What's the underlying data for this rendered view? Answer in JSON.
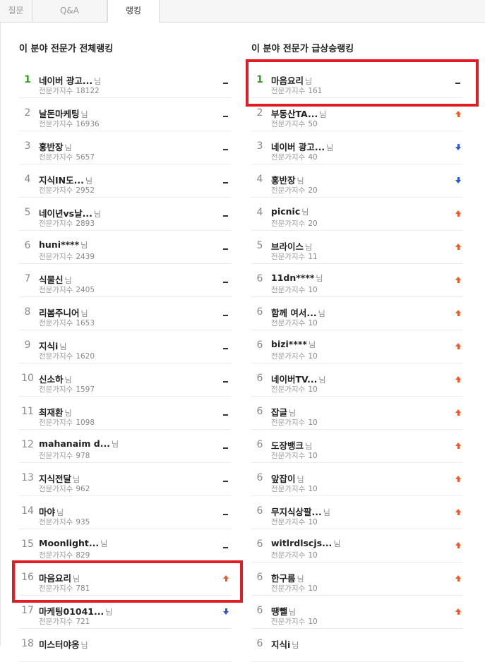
{
  "tabs": [
    {
      "label": "질문",
      "active": false
    },
    {
      "label": "Q&A",
      "active": false
    },
    {
      "label": "랭킹",
      "active": true
    }
  ],
  "colors": {
    "top_rank": "#3a9a2c",
    "trend_up": "#f05a28",
    "trend_down": "#2f56d6",
    "highlight": "#e31b23"
  },
  "left_column": {
    "title": "이 분야 전문가 전체랭킹",
    "rows": [
      {
        "rank": "1",
        "name": "네이버 광고...",
        "suffix": "님",
        "score_label": "전문가지수",
        "score": "18122",
        "trend": "dash"
      },
      {
        "rank": "2",
        "name": "날돈마케팅",
        "suffix": "님",
        "score_label": "전문가지수",
        "score": "16936",
        "trend": "dash"
      },
      {
        "rank": "3",
        "name": "홍반장",
        "suffix": "님",
        "score_label": "전문가지수",
        "score": "5657",
        "trend": "dash"
      },
      {
        "rank": "4",
        "name": "지식IN도...",
        "suffix": "님",
        "score_label": "전문가지수",
        "score": "2952",
        "trend": "dash"
      },
      {
        "rank": "5",
        "name": "네이년vs날...",
        "suffix": "님",
        "score_label": "전문가지수",
        "score": "2893",
        "trend": "dash"
      },
      {
        "rank": "6",
        "name": "huni****",
        "suffix": "님",
        "score_label": "전문가지수",
        "score": "2439",
        "trend": "dash"
      },
      {
        "rank": "7",
        "name": "식물신",
        "suffix": "님",
        "score_label": "전문가지수",
        "score": "2405",
        "trend": "dash"
      },
      {
        "rank": "8",
        "name": "리봄주니어",
        "suffix": "님",
        "score_label": "전문가지수",
        "score": "1653",
        "trend": "dash"
      },
      {
        "rank": "9",
        "name": "지식i",
        "suffix": "님",
        "score_label": "전문가지수",
        "score": "1620",
        "trend": "dash"
      },
      {
        "rank": "10",
        "name": "신소하",
        "suffix": "님",
        "score_label": "전문가지수",
        "score": "1597",
        "trend": "dash"
      },
      {
        "rank": "11",
        "name": "최재환",
        "suffix": "님",
        "score_label": "전문가지수",
        "score": "1098",
        "trend": "dash"
      },
      {
        "rank": "12",
        "name": "mahanaim d...",
        "suffix": "님",
        "score_label": "전문가지수",
        "score": "978",
        "trend": "dash"
      },
      {
        "rank": "13",
        "name": "지식전달",
        "suffix": "님",
        "score_label": "전문가지수",
        "score": "962",
        "trend": "dash"
      },
      {
        "rank": "14",
        "name": "마야",
        "suffix": "님",
        "score_label": "전문가지수",
        "score": "935",
        "trend": "dash"
      },
      {
        "rank": "15",
        "name": "Moonlight...",
        "suffix": "님",
        "score_label": "전문가지수",
        "score": "829",
        "trend": "dash"
      },
      {
        "rank": "16",
        "name": "마음요리",
        "suffix": "님",
        "score_label": "전문가지수",
        "score": "781",
        "trend": "up",
        "highlighted": true
      },
      {
        "rank": "17",
        "name": "마케팅01041...",
        "suffix": "님",
        "score_label": "전문가지수",
        "score": "721",
        "trend": "down"
      },
      {
        "rank": "18",
        "name": "미스터야옹",
        "suffix": "님",
        "score_label": "",
        "score": "",
        "trend": "none"
      }
    ]
  },
  "right_column": {
    "title": "이 분야 전문가 급상승랭킹",
    "rows": [
      {
        "rank": "1",
        "name": "마음요리",
        "suffix": "님",
        "score_label": "전문가지수",
        "score": "161",
        "trend": "dash",
        "highlighted": true
      },
      {
        "rank": "2",
        "name": "부동산TA...",
        "suffix": "님",
        "score_label": "전문가지수",
        "score": "50",
        "trend": "up"
      },
      {
        "rank": "3",
        "name": "네이버 광고...",
        "suffix": "님",
        "score_label": "전문가지수",
        "score": "40",
        "trend": "down"
      },
      {
        "rank": "4",
        "name": "홍반장",
        "suffix": "님",
        "score_label": "전문가지수",
        "score": "20",
        "trend": "down"
      },
      {
        "rank": "4",
        "name": "picnic",
        "suffix": "님",
        "score_label": "전문가지수",
        "score": "20",
        "trend": "up"
      },
      {
        "rank": "5",
        "name": "브라이스",
        "suffix": "님",
        "score_label": "전문가지수",
        "score": "11",
        "trend": "up"
      },
      {
        "rank": "6",
        "name": "11dn****",
        "suffix": "님",
        "score_label": "전문가지수",
        "score": "10",
        "trend": "up"
      },
      {
        "rank": "6",
        "name": "함께 여서...",
        "suffix": "님",
        "score_label": "전문가지수",
        "score": "10",
        "trend": "up"
      },
      {
        "rank": "6",
        "name": "bizi****",
        "suffix": "님",
        "score_label": "전문가지수",
        "score": "10",
        "trend": "up"
      },
      {
        "rank": "6",
        "name": "네이버TV...",
        "suffix": "님",
        "score_label": "전문가지수",
        "score": "10",
        "trend": "up"
      },
      {
        "rank": "6",
        "name": "잡글",
        "suffix": "님",
        "score_label": "전문가지수",
        "score": "10",
        "trend": "up"
      },
      {
        "rank": "6",
        "name": "도장뱅크",
        "suffix": "님",
        "score_label": "전문가지수",
        "score": "10",
        "trend": "up"
      },
      {
        "rank": "6",
        "name": "앞잡이",
        "suffix": "님",
        "score_label": "전문가지수",
        "score": "10",
        "trend": "up"
      },
      {
        "rank": "6",
        "name": "무지식상팔...",
        "suffix": "님",
        "score_label": "전문가지수",
        "score": "10",
        "trend": "up"
      },
      {
        "rank": "6",
        "name": "witlrdlscjs...",
        "suffix": "님",
        "score_label": "전문가지수",
        "score": "10",
        "trend": "up"
      },
      {
        "rank": "6",
        "name": "한구름",
        "suffix": "님",
        "score_label": "전문가지수",
        "score": "10",
        "trend": "up"
      },
      {
        "rank": "6",
        "name": "땡뺄",
        "suffix": "님",
        "score_label": "전문가지수",
        "score": "10",
        "trend": "up"
      },
      {
        "rank": "6",
        "name": "지식i",
        "suffix": "님",
        "score_label": "",
        "score": "",
        "trend": "none"
      }
    ]
  }
}
